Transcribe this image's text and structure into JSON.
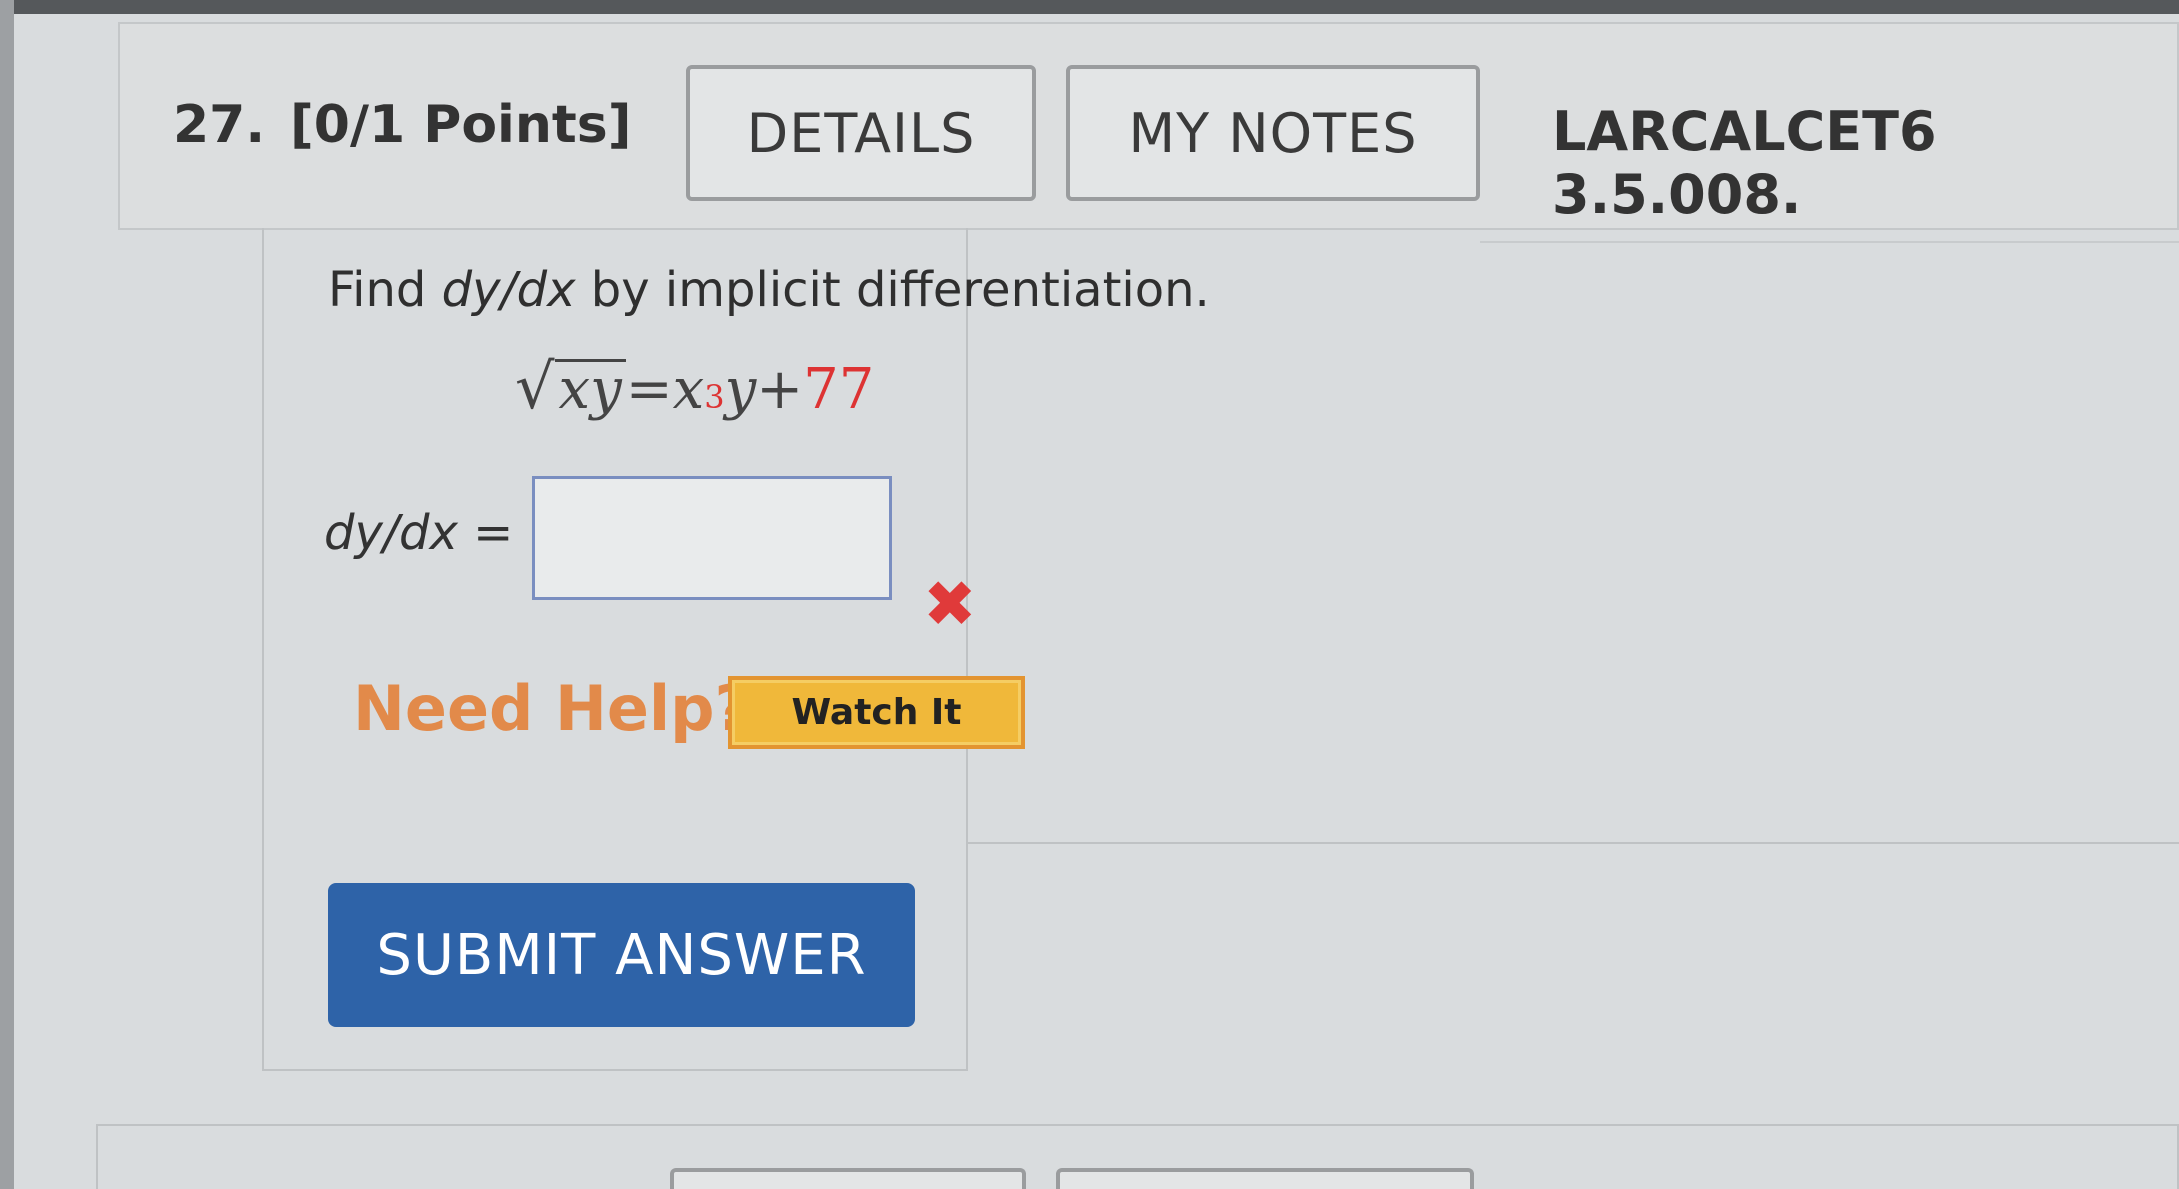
{
  "question": {
    "number": "27.",
    "points": "[0/1 Points]",
    "details_label": "DETAILS",
    "notes_label": "MY NOTES",
    "problem_id": "LARCALCET6 3.5.008."
  },
  "prompt": {
    "before": "Find ",
    "var": "dy/dx",
    "after": " by implicit differentiation."
  },
  "equation": {
    "sqrt_symbol": "√",
    "radicand": "xy",
    "equals": " = ",
    "x": "x",
    "exponent": "3",
    "y": "y",
    "plus": " + ",
    "constant": "77"
  },
  "answer": {
    "label_var": "dy/dx",
    "label_eq": " =",
    "value": "",
    "status_icon": "x-mark-icon",
    "status_glyph": "✖",
    "status_color": "#e03a3a"
  },
  "help": {
    "need_help": "Need Help?",
    "watch_label": "Watch It"
  },
  "submit_label": "SUBMIT ANSWER",
  "colors": {
    "submit_bg": "#2e63a8",
    "watch_bg": "#f0b83a",
    "need_help": "#e28a4a",
    "constant": "#d33333"
  }
}
